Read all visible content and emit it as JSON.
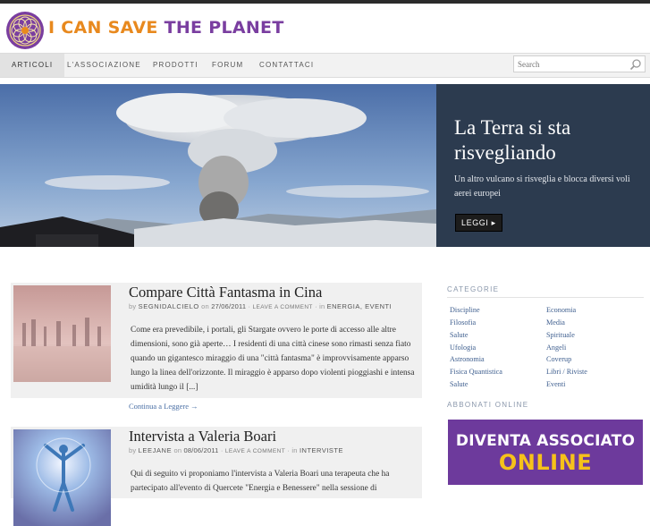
{
  "header": {
    "logo_word1": "I can save",
    "logo_word2": "the planet",
    "brand_colors": {
      "orange": "#e8891e",
      "purple": "#7a3ea0"
    }
  },
  "nav": {
    "items": [
      {
        "label": "ARTICOLI",
        "active": true
      },
      {
        "label": "L'ASSOCIAZIONE",
        "active": false
      },
      {
        "label": "PRODOTTI",
        "active": false
      },
      {
        "label": "FORUM",
        "active": false
      },
      {
        "label": "CONTATTACI",
        "active": false
      }
    ]
  },
  "search": {
    "placeholder": "Search",
    "icon": "magnifier-icon"
  },
  "hero": {
    "title": "La Terra si sta risvegliando",
    "subtitle": "Un altro vulcano si risveglia e blocca diversi voli aerei europei",
    "button_label": "LEGGI ▸"
  },
  "posts": [
    {
      "title": "Compare Città Fantasma in Cina",
      "by": "by",
      "author": "SEGNIDALCIELO",
      "on": "on",
      "date": "27/06/2011",
      "sep": "·",
      "leave_comment": "LEAVE A COMMENT",
      "in": "in",
      "categories": "ENERGIA, EVENTI",
      "excerpt": "Come era prevedibile, i portali, gli Stargate ovvero le porte di accesso alle altre dimensioni, sono già aperte… I residenti di una città cinese sono rimasti senza fiato quando un gigantesco miraggio di una \"città fantasma\" è improvvisamente apparso lungo la linea dell'orizzonte. Il miraggio è apparso dopo violenti pioggiashi e intensa umidità lungo il [...]",
      "read_more": "Continua a Leggere →"
    },
    {
      "title": "Intervista a Valeria Boari",
      "by": "by",
      "author": "LEEJANE",
      "on": "on",
      "date": "08/06/2011",
      "sep": "·",
      "leave_comment": "LEAVE A COMMENT",
      "in": "in",
      "categories": "INTERVISTE",
      "excerpt": "Qui di seguito vi proponiamo l'intervista a Valeria Boari una terapeuta che ha partecipato all'evento di Quercete \"Energia e Benessere\" nella sessione di"
    }
  ],
  "sidebar": {
    "categories_heading": "CATEGORIE",
    "categories_left": [
      "Discipline",
      "Filosofia",
      "Salute",
      "Ufologia",
      "Astronomia",
      "Fisica Quantistica",
      "Salute"
    ],
    "categories_right": [
      "Economia",
      "Media",
      "Spirituale",
      "Angeli",
      "Coverup",
      "Libri / Riviste",
      "Eventi"
    ],
    "subscribe_heading": "ABBONATI ONLINE",
    "banner_line1": "DIVENTA ASSOCIATO",
    "banner_line2": "ONLINE"
  }
}
